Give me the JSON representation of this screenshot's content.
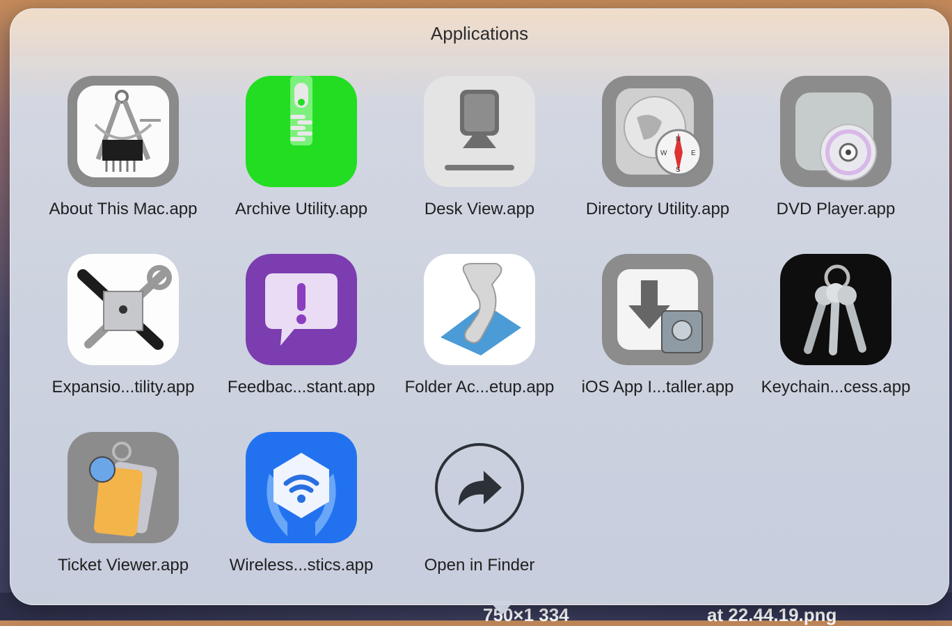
{
  "stack": {
    "title": "Applications",
    "items": [
      {
        "label": "About This Mac.app",
        "icon": "calipers-chip-icon"
      },
      {
        "label": "Archive Utility.app",
        "icon": "zipper-icon"
      },
      {
        "label": "Desk View.app",
        "icon": "desk-camera-icon"
      },
      {
        "label": "Directory Utility.app",
        "icon": "globe-compass-icon"
      },
      {
        "label": "DVD Player.app",
        "icon": "dvd-disc-icon"
      },
      {
        "label": "Expansio...tility.app",
        "icon": "tools-chip-icon"
      },
      {
        "label": "Feedbac...stant.app",
        "icon": "exclamation-bubble-icon"
      },
      {
        "label": "Folder Ac...etup.app",
        "icon": "script-scroll-icon"
      },
      {
        "label": "iOS App I...taller.app",
        "icon": "download-drive-icon"
      },
      {
        "label": "Keychain...cess.app",
        "icon": "keys-icon"
      },
      {
        "label": "Ticket Viewer.app",
        "icon": "tickets-icon"
      },
      {
        "label": "Wireless...stics.app",
        "icon": "wifi-shield-icon"
      },
      {
        "label": "Open in Finder",
        "icon": "open-arrow-icon"
      }
    ]
  },
  "desktop": {
    "left_label": "750×1 334",
    "right_label": "at 22.44.19.png"
  }
}
